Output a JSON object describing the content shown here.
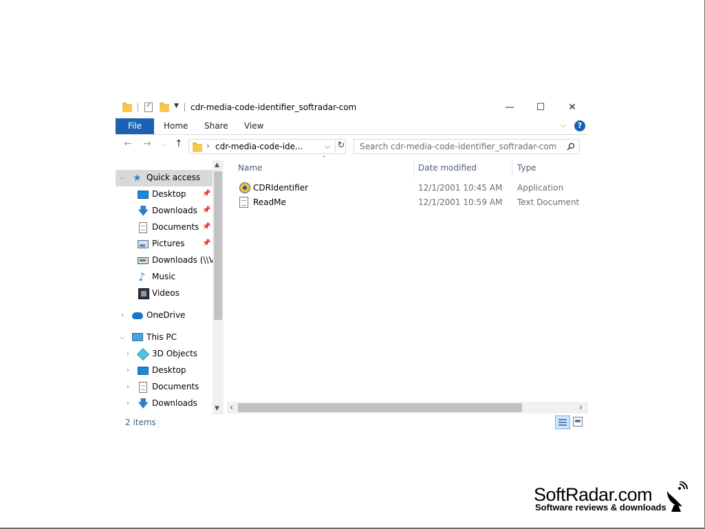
{
  "window": {
    "title": "cdr-media-code-identifier_softradar-com"
  },
  "ribbon": {
    "tabs": [
      "File",
      "Home",
      "Share",
      "View"
    ],
    "help_label": "?"
  },
  "titlebar_buttons": {
    "minimize": "—",
    "maximize": "☐",
    "close": "✕"
  },
  "address": {
    "path": "cdr-media-code-ide...",
    "separator": "›"
  },
  "search": {
    "placeholder": "Search cdr-media-code-identifier_softradar-com"
  },
  "navpane": {
    "items": [
      {
        "label": "Quick access",
        "icon": "star-icon",
        "pinned": false
      },
      {
        "label": "Desktop",
        "icon": "desktop-icon",
        "pinned": true
      },
      {
        "label": "Downloads",
        "icon": "downloads-icon",
        "pinned": true
      },
      {
        "label": "Documents",
        "icon": "documents-icon",
        "pinned": true
      },
      {
        "label": "Pictures",
        "icon": "pictures-icon",
        "pinned": true
      },
      {
        "label": "Downloads (\\\\VE",
        "icon": "network-drive-icon",
        "pinned": false
      },
      {
        "label": "Music",
        "icon": "music-icon",
        "pinned": false
      },
      {
        "label": "Videos",
        "icon": "videos-icon",
        "pinned": false
      },
      {
        "label": "OneDrive",
        "icon": "onedrive-icon",
        "pinned": false
      },
      {
        "label": "This PC",
        "icon": "this-pc-icon",
        "pinned": false
      },
      {
        "label": "3D Objects",
        "icon": "3d-objects-icon",
        "pinned": false
      },
      {
        "label": "Desktop",
        "icon": "desktop-icon",
        "pinned": false
      },
      {
        "label": "Documents",
        "icon": "documents-icon",
        "pinned": false
      },
      {
        "label": "Downloads",
        "icon": "downloads-icon",
        "pinned": false
      }
    ]
  },
  "files": {
    "columns": [
      "Name",
      "Date modified",
      "Type"
    ],
    "rows": [
      {
        "name": "CDRIdentifier",
        "date": "12/1/2001 10:45 AM",
        "type": "Application",
        "icon": "application-icon"
      },
      {
        "name": "ReadMe",
        "date": "12/1/2001 10:59 AM",
        "type": "Text Document",
        "icon": "text-document-icon"
      }
    ]
  },
  "status": {
    "item_count": "2 items"
  },
  "watermark": {
    "title": "SoftRadar.com",
    "subtitle": "Software reviews & downloads"
  },
  "colors": {
    "accent": "#1a63b4",
    "selection": "#cce8ff"
  }
}
